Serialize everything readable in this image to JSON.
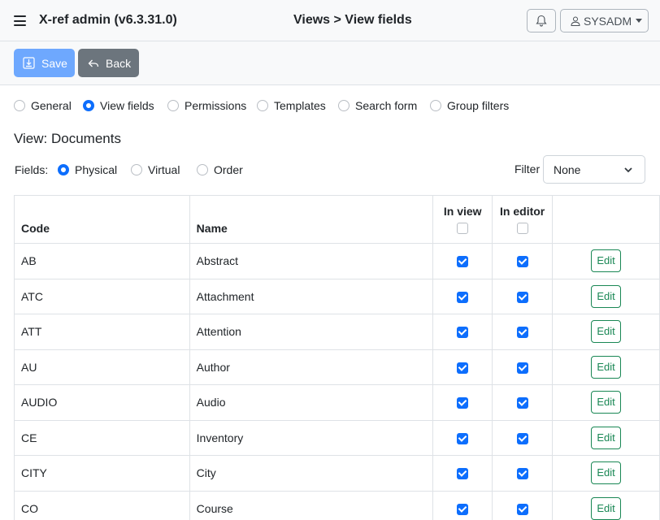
{
  "header": {
    "app_title": "X-ref admin (v6.3.31.0)",
    "breadcrumb": "Views > View fields",
    "user_label": "SYSADM"
  },
  "toolbar": {
    "save_label": "Save",
    "back_label": "Back"
  },
  "tabs": [
    {
      "label": "General",
      "selected": false
    },
    {
      "label": "View fields",
      "selected": true
    },
    {
      "label": "Permissions",
      "selected": false
    },
    {
      "label": "Templates",
      "selected": false
    },
    {
      "label": "Search form",
      "selected": false
    },
    {
      "label": "Group filters",
      "selected": false
    }
  ],
  "view_title": "View: Documents",
  "fields": {
    "label": "Fields:",
    "options": [
      {
        "label": "Physical",
        "selected": true
      },
      {
        "label": "Virtual",
        "selected": false
      },
      {
        "label": "Order",
        "selected": false
      }
    ]
  },
  "filter": {
    "label": "Filter",
    "value": "None"
  },
  "table": {
    "columns": [
      "Code",
      "Name",
      "In view",
      "In editor",
      ""
    ],
    "header_in_view_checked": false,
    "header_in_editor_checked": false,
    "edit_label": "Edit",
    "rows": [
      {
        "code": "AB",
        "name": "Abstract",
        "in_view": true,
        "in_editor": true
      },
      {
        "code": "ATC",
        "name": "Attachment",
        "in_view": true,
        "in_editor": true
      },
      {
        "code": "ATT",
        "name": "Attention",
        "in_view": true,
        "in_editor": true
      },
      {
        "code": "AU",
        "name": "Author",
        "in_view": true,
        "in_editor": true
      },
      {
        "code": "AUDIO",
        "name": "Audio",
        "in_view": true,
        "in_editor": true
      },
      {
        "code": "CE",
        "name": "Inventory",
        "in_view": true,
        "in_editor": true
      },
      {
        "code": "CITY",
        "name": "City",
        "in_view": true,
        "in_editor": true
      },
      {
        "code": "CO",
        "name": "Course",
        "in_view": true,
        "in_editor": true
      }
    ]
  },
  "colors": {
    "primary": "#0d6efd",
    "save_button": "#6ea8fe",
    "back_button": "#6c757d",
    "edit_button": "#198754"
  }
}
